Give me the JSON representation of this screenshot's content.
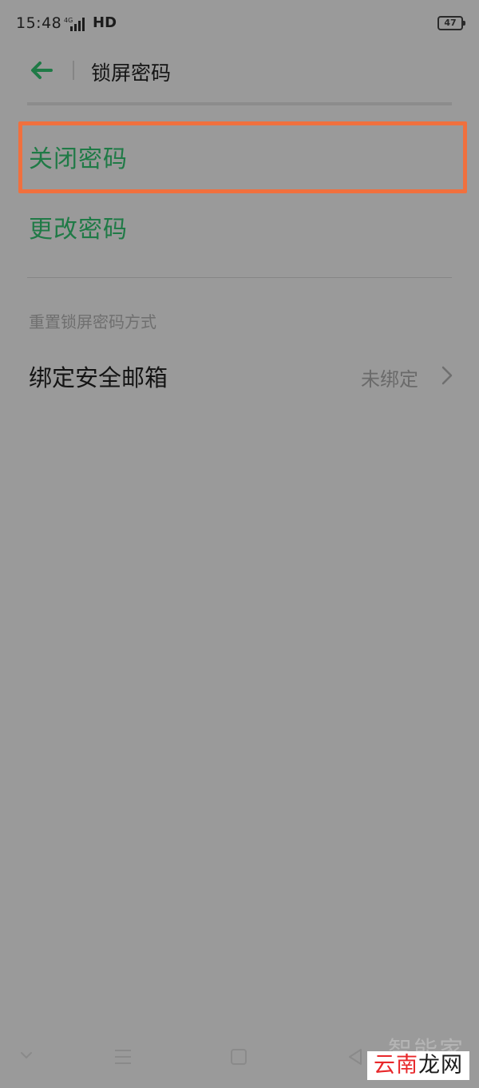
{
  "status_bar": {
    "time": "15:48",
    "network": "HD",
    "battery": "47"
  },
  "header": {
    "title": "锁屏密码"
  },
  "options": {
    "close_password": "关闭密码",
    "change_password": "更改密码"
  },
  "reset_section": {
    "label": "重置锁屏密码方式",
    "bind_email": {
      "label": "绑定安全邮箱",
      "status": "未绑定"
    }
  },
  "watermark": {
    "top_text": "智能家",
    "part1": "云南",
    "part2": "龙网"
  },
  "colors": {
    "accent": "#1f7a46",
    "highlight": "#f0703e",
    "overlay": "#9a9a9a"
  },
  "icons": {
    "back": "back-arrow-icon",
    "chevron": "chevron-right-icon",
    "signal": "signal-icon",
    "battery": "battery-icon"
  }
}
